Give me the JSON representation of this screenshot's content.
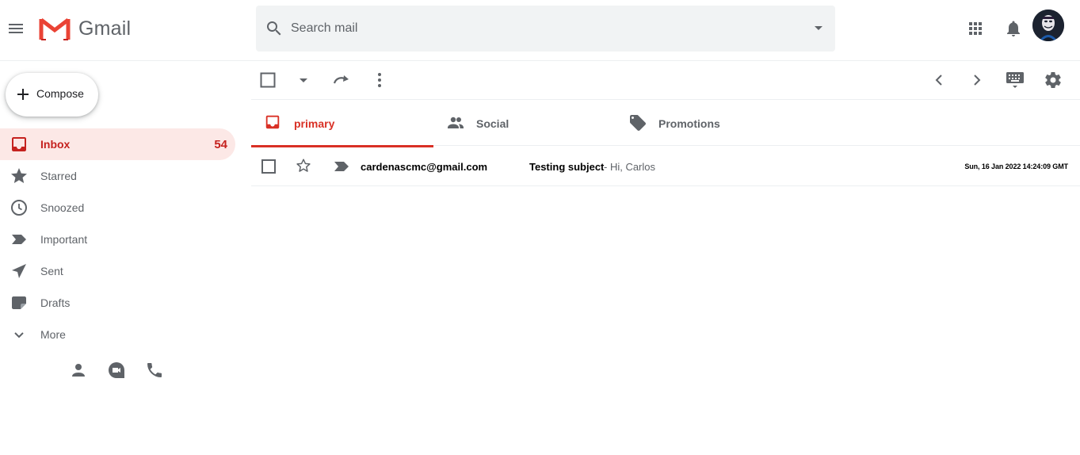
{
  "app": {
    "name": "Gmail"
  },
  "colors": {
    "accent": "#d93025",
    "active_bg": "#fce8e6",
    "icon_gray": "#5f6368"
  },
  "header": {
    "icons": [
      "menu-icon",
      "gmail-logo",
      "search-icon",
      "dropdown-icon",
      "apps-icon",
      "bell-icon",
      "avatar"
    ]
  },
  "search": {
    "placeholder": "Search mail",
    "value": ""
  },
  "compose": {
    "label": "Compose"
  },
  "sidebar": {
    "items": [
      {
        "label": "Inbox",
        "count": "54",
        "icon": "inbox-icon",
        "active": true
      },
      {
        "label": "Starred",
        "icon": "star-icon"
      },
      {
        "label": "Snoozed",
        "icon": "clock-icon"
      },
      {
        "label": "Important",
        "icon": "important-icon"
      },
      {
        "label": "Sent",
        "icon": "send-icon"
      },
      {
        "label": "Drafts",
        "icon": "draft-icon"
      },
      {
        "label": "More",
        "icon": "chevron-down-icon"
      }
    ],
    "bottom_icons": [
      "person-icon",
      "meet-icon",
      "phone-icon"
    ]
  },
  "toolbar": {
    "icons": [
      "select-all-checkbox",
      "select-dropdown-icon",
      "refresh-icon",
      "more-vert-icon",
      "chevron-left-icon",
      "chevron-right-icon",
      "keyboard-icon",
      "settings-icon"
    ]
  },
  "tabs": [
    {
      "label": "primary",
      "icon": "inbox-icon",
      "active": true
    },
    {
      "label": "Social",
      "icon": "people-icon"
    },
    {
      "label": "Promotions",
      "icon": "tag-icon"
    }
  ],
  "emails": [
    {
      "sender": "cardenascmc@gmail.com",
      "subject": "Testing subject",
      "snippet": "- Hi, Carlos",
      "date": "Sun, 16 Jan 2022 14:24:09 GMT",
      "starred": false,
      "important": true
    }
  ]
}
